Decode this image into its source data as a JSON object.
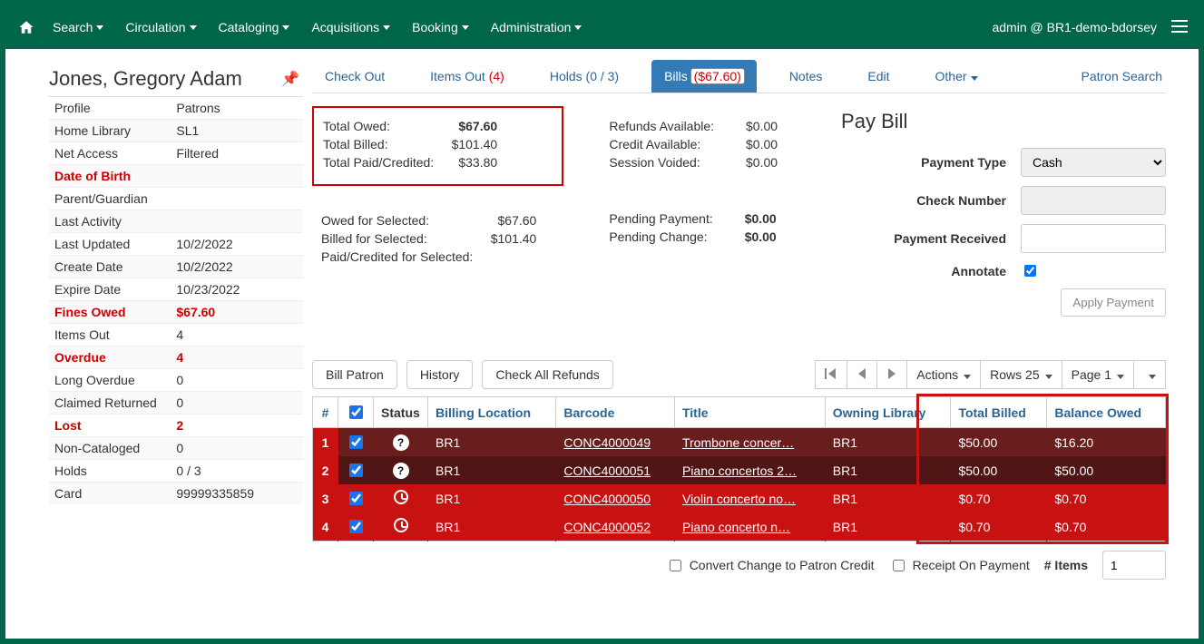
{
  "nav": {
    "items": [
      "Search",
      "Circulation",
      "Cataloging",
      "Acquisitions",
      "Booking",
      "Administration"
    ],
    "user": "admin @ BR1-demo-bdorsey"
  },
  "patron": {
    "name": "Jones, Gregory Adam",
    "rows": [
      {
        "label": "Profile",
        "value": "Patrons"
      },
      {
        "label": "Home Library",
        "value": "SL1"
      },
      {
        "label": "Net Access",
        "value": "Filtered"
      },
      {
        "label": "Date of Birth",
        "value": "",
        "style": "red"
      },
      {
        "label": "Parent/Guardian",
        "value": ""
      },
      {
        "label": "Last Activity",
        "value": ""
      },
      {
        "label": "Last Updated",
        "value": "10/2/2022"
      },
      {
        "label": "Create Date",
        "value": "10/2/2022"
      },
      {
        "label": "Expire Date",
        "value": "10/23/2022"
      },
      {
        "label": "Fines Owed",
        "value": "$67.60",
        "style": "red"
      },
      {
        "label": "Items Out",
        "value": "4"
      },
      {
        "label": "Overdue",
        "value": "4",
        "style": "red"
      },
      {
        "label": "Long Overdue",
        "value": "0"
      },
      {
        "label": "Claimed Returned",
        "value": "0"
      },
      {
        "label": "Lost",
        "value": "2",
        "style": "red"
      },
      {
        "label": "Non-Cataloged",
        "value": "0"
      },
      {
        "label": "Holds",
        "value": "0 / 3"
      },
      {
        "label": "Card",
        "value": "99999335859"
      }
    ]
  },
  "tabs": {
    "checkout": "Check Out",
    "items_out": "Items Out",
    "items_out_count": "(4)",
    "holds": "Holds (0 / 3)",
    "bills": "Bills",
    "bills_amount": "($67.60)",
    "notes": "Notes",
    "edit": "Edit",
    "other": "Other",
    "patron_search": "Patron Search"
  },
  "totals_box1": [
    {
      "label": "Total Owed:",
      "value": "$67.60",
      "bold": true
    },
    {
      "label": "Total Billed:",
      "value": "$101.40"
    },
    {
      "label": "Total Paid/Credited:",
      "value": "$33.80"
    }
  ],
  "totals_box2": [
    {
      "label": "Refunds Available:",
      "value": "$0.00"
    },
    {
      "label": "Credit Available:",
      "value": "$0.00"
    },
    {
      "label": "Session Voided:",
      "value": "$0.00"
    }
  ],
  "totals_box3": [
    {
      "label": "Owed for Selected:",
      "value": "$67.60"
    },
    {
      "label": "Billed for Selected:",
      "value": "$101.40"
    },
    {
      "label": "Paid/Credited for Selected:",
      "value": ""
    }
  ],
  "totals_box4": [
    {
      "label": "Pending Payment:",
      "value": "$0.00",
      "bold": true
    },
    {
      "label": "Pending Change:",
      "value": "$0.00",
      "bold": true
    }
  ],
  "paybill": {
    "title": "Pay Bill",
    "labels": {
      "payment_type": "Payment Type",
      "check_number": "Check Number",
      "payment_received": "Payment Received",
      "annotate": "Annotate",
      "apply": "Apply Payment"
    },
    "payment_type_value": "Cash"
  },
  "table_buttons": {
    "bill_patron": "Bill Patron",
    "history": "History",
    "check_refunds": "Check All Refunds",
    "actions": "Actions",
    "rows": "Rows 25",
    "page": "Page 1"
  },
  "grid": {
    "headers": [
      "#",
      "",
      "Status",
      "Billing Location",
      "Barcode",
      "Title",
      "Owning Library",
      "Total Billed",
      "Balance Owed"
    ],
    "rows": [
      {
        "n": "1",
        "status": "?",
        "loc": "BR1",
        "barcode": "CONC4000049",
        "title": "Trombone concer…",
        "own": "BR1",
        "billed": "$50.00",
        "bal": "$16.20",
        "cls": "r1"
      },
      {
        "n": "2",
        "status": "?",
        "loc": "BR1",
        "barcode": "CONC4000051",
        "title": "Piano concertos 2…",
        "own": "BR1",
        "billed": "$50.00",
        "bal": "$50.00",
        "cls": "r2"
      },
      {
        "n": "3",
        "status": "clock",
        "loc": "BR1",
        "barcode": "CONC4000050",
        "title": "Violin concerto no…",
        "own": "BR1",
        "billed": "$0.70",
        "bal": "$0.70",
        "cls": "r3"
      },
      {
        "n": "4",
        "status": "clock",
        "loc": "BR1",
        "barcode": "CONC4000052",
        "title": "Piano concerto n…",
        "own": "BR1",
        "billed": "$0.70",
        "bal": "$0.70",
        "cls": "r4"
      }
    ]
  },
  "footer": {
    "convert": "Convert Change to Patron Credit",
    "receipt": "Receipt On Payment",
    "items_label": "# Items",
    "items_value": "1"
  }
}
